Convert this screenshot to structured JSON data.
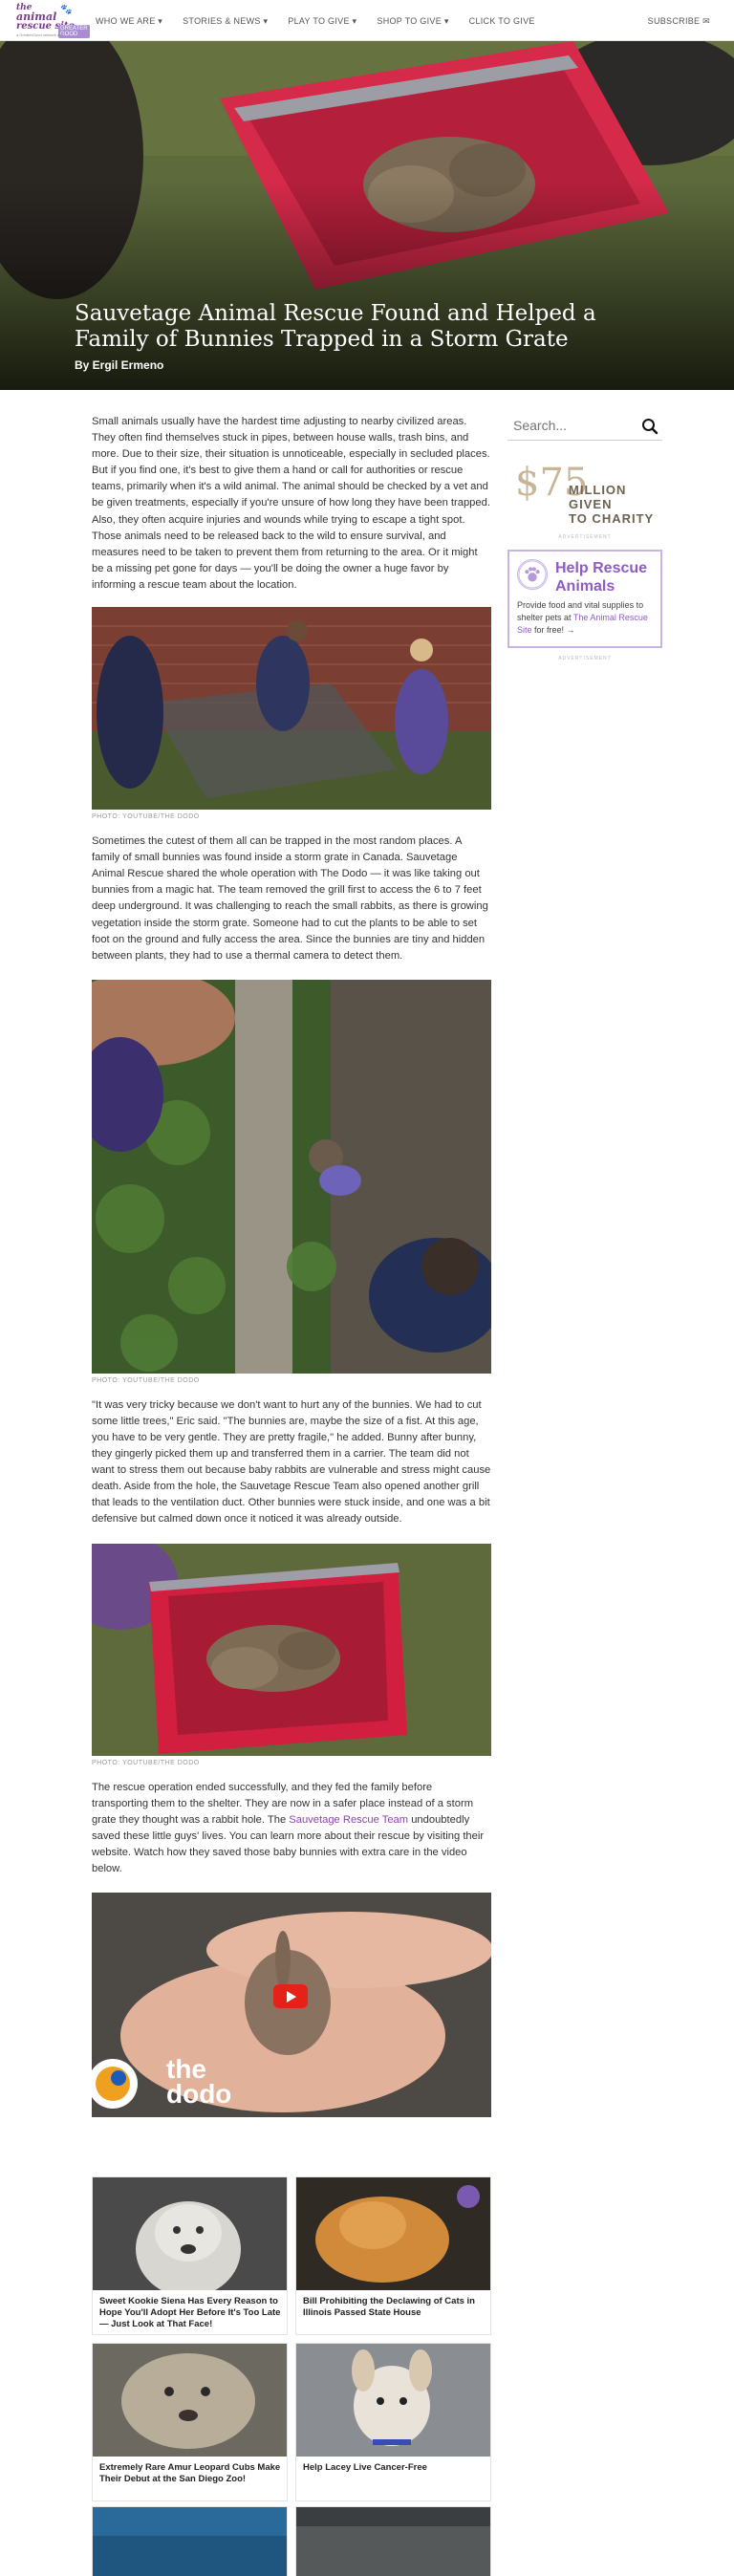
{
  "site": {
    "logo_line1": "the",
    "logo_line2": "animal",
    "logo_line3": "rescue site",
    "logo_badge": "GREATER GOOD",
    "logo_tag": "a GreaterGood network site"
  },
  "nav": {
    "items": [
      "WHO WE ARE ▾",
      "STORIES & NEWS ▾",
      "PLAY TO GIVE ▾",
      "SHOP TO GIVE ▾",
      "CLICK TO GIVE"
    ],
    "subscribe": "SUBSCRIBE ✉"
  },
  "hero": {
    "title": "Sauvetage Animal Rescue Found and Helped a Family of Bunnies Trapped in a Storm Grate",
    "byline": "By Ergil Ermeno"
  },
  "article": {
    "p1": "Small animals usually have the hardest time adjusting to nearby civilized areas. They often find themselves stuck in pipes, between house walls, trash bins, and more. Due to their size, their situation is unnoticeable, especially in secluded places. But if you find one, it's best to give them a hand or call for authorities or rescue teams, primarily when it's a wild animal. The animal should be checked by a vet and be given treatments, especially if you're unsure of how long they have been trapped. Also, they often acquire injuries and wounds while trying to escape a tight spot. Those animals need to be released back to the wild to ensure survival, and measures need to be taken to prevent them from returning to the area. Or it might be a missing pet gone for days — you'll be doing the owner a huge favor by informing a rescue team about the location.",
    "caption1": "PHOTO: YOUTUBE/THE DODO",
    "p2": "Sometimes the cutest of them all can be trapped in the most random places. A family of small bunnies was found inside a storm grate in Canada. Sauvetage Animal Rescue shared the whole operation with The Dodo — it was like taking out bunnies from a magic hat. The team removed the grill first to access the 6 to 7 feet deep underground. It was challenging to reach the small rabbits, as there is growing vegetation inside the storm grate. Someone had to cut the plants to be able to set foot on the ground and fully access the area. Since the bunnies are tiny and hidden between plants, they had to use a thermal camera to detect them.",
    "caption2": "PHOTO: YOUTUBE/THE DODO",
    "p3": "\"It was very tricky because we don't want to hurt any of the bunnies. We had to cut some little trees,\" Eric said. \"The bunnies are, maybe the size of a fist. At this age, you have to be very gentle. They are pretty fragile,\" he added. Bunny after bunny, they gingerly picked them up and transferred them in a carrier. The team did not want to stress them out because baby rabbits are vulnerable and stress might cause death. Aside from the hole, the Sauvetage Rescue Team also opened another grill that leads to the ventilation duct. Other bunnies were stuck inside, and one was a bit defensive but calmed down once it noticed it was already outside.",
    "caption3": "PHOTO: YOUTUBE/THE DODO",
    "p4a": "The rescue operation ended successfully, and they fed the family before transporting them to the shelter. They are now in a safer place instead of a storm grate they thought was a rabbit hole. The ",
    "p4link": "Sauvetage Rescue Team",
    "p4b": " undoubtedly saved these little guys' lives. You can learn more about their rescue by visiting their website. Watch how they saved those baby bunnies with extra care in the video below.",
    "video_brand": "the dodo"
  },
  "sidebar": {
    "search_placeholder": "Search...",
    "money_number": "$75",
    "money_text1": "MILLION GIVEN",
    "money_text2": "TO CHARITY",
    "advert": "ADVERTISEMENT",
    "help_title": "Help Rescue Animals",
    "help_text_a": "Provide food and vital supplies to shelter pets at ",
    "help_link": "The Animal Rescue Site",
    "help_text_b": " for free! →"
  },
  "related": [
    {
      "title": "Sweet Kookie Siena Has Every Reason to Hope You'll Adopt Her Before It's Too Late — Just Look at That Face!"
    },
    {
      "title": "Bill Prohibiting the Declawing of Cats in Illinois Passed State House"
    },
    {
      "title": "Extremely Rare Amur Leopard Cubs Make Their Debut at the San Diego Zoo!"
    },
    {
      "title": "Help Lacey Live Cancer-Free"
    }
  ],
  "colors": {
    "accent": "#8e44ad",
    "help_border": "#c7b3e6",
    "youtube_red": "#e62117"
  }
}
